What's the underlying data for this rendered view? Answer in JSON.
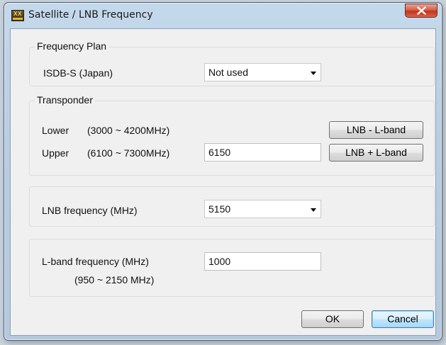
{
  "window": {
    "title": "Satellite / LNB Frequency",
    "icon_text": "XX"
  },
  "frequency_plan": {
    "legend": "Frequency Plan",
    "label": "ISDB-S (Japan)",
    "selected": "Not used"
  },
  "transponder": {
    "legend": "Transponder",
    "lower_label": "Lower",
    "lower_range": "(3000 ~ 4200MHz)",
    "upper_label": "Upper",
    "upper_range": "(6100 ~ 7300MHz)",
    "upper_value": "6150",
    "lnb_minus_label": "LNB - L-band",
    "lnb_plus_label": "LNB + L-band"
  },
  "lnb": {
    "label": "LNB frequency (MHz)",
    "selected": "5150"
  },
  "lband": {
    "label": "L-band frequency (MHz)",
    "range": "(950 ~ 2150 MHz)",
    "value": "1000"
  },
  "footer": {
    "ok_label": "OK",
    "cancel_label": "Cancel"
  },
  "colors": {
    "titlebar": "#b8cde2",
    "close_button": "#c1341c",
    "default_button": "#3c7fb1"
  },
  "icons": [
    "app-logo-icon",
    "close-x-icon",
    "dropdown-arrow-icon"
  ]
}
